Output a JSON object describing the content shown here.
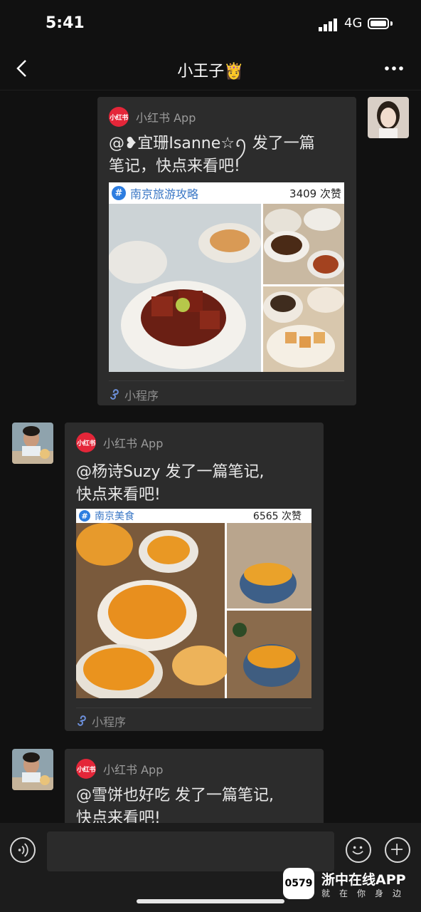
{
  "status_bar": {
    "time": "5:41",
    "network": "4G"
  },
  "nav": {
    "title": "小王子👸"
  },
  "messages": [
    {
      "app_name": "小红书 App",
      "logo_text": "小红书",
      "text_line1": "@❥宜珊Isanne☆ꪆ 发了一篇",
      "text_line2": "笔记，快点来看吧!",
      "tag": "南京旅游攻略",
      "likes": "3409 次赞",
      "footer": "小程序"
    },
    {
      "app_name": "小红书 App",
      "logo_text": "小红书",
      "text_line1": "@杨诗Suzy 发了一篇笔记,",
      "text_line2": "快点来看吧!",
      "tag": "南京美食",
      "likes": "6565  次赞",
      "footer": "小程序"
    },
    {
      "app_name": "小红书 App",
      "logo_text": "小红书",
      "text_line1": "@雪饼也好吃 发了一篇笔记,",
      "text_line2": "快点来看吧!"
    }
  ],
  "watermark": {
    "logo": "0579",
    "name": "浙中在线APP",
    "slogan": "就在你身边"
  },
  "colors": {
    "background": "#111111",
    "card": "#2c2c2c",
    "brand_red": "#e42639",
    "tag_blue": "#3a77c5"
  }
}
